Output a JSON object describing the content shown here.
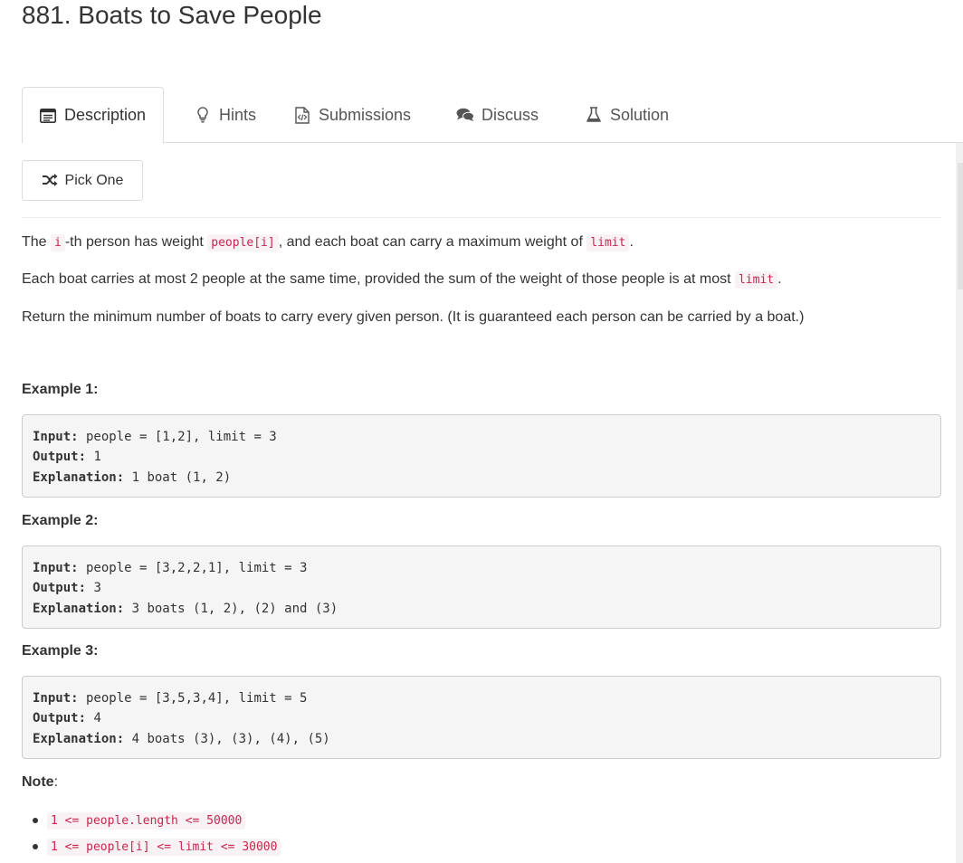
{
  "problem": {
    "title": "881. Boats to Save People"
  },
  "tabs": [
    {
      "label": "Description",
      "icon": "description-icon"
    },
    {
      "label": "Hints",
      "icon": "lightbulb-icon"
    },
    {
      "label": "Submissions",
      "icon": "file-code-icon"
    },
    {
      "label": "Discuss",
      "icon": "comments-icon"
    },
    {
      "label": "Solution",
      "icon": "flask-icon"
    }
  ],
  "pick_one": {
    "label": "Pick One",
    "icon": "shuffle-icon"
  },
  "description": {
    "p1": {
      "t1": "The ",
      "c1": "i",
      "t2": "-th person has weight ",
      "c2": "people[i]",
      "t3": ", and each boat can carry a maximum weight of ",
      "c3": "limit",
      "t4": "."
    },
    "p2": {
      "t1": "Each boat carries at most 2 people at the same time, provided the sum of the weight of those people is at most ",
      "c1": "limit",
      "t2": "."
    },
    "p3": "Return the minimum number of boats to carry every given person.  (It is guaranteed each person can be carried by a boat.)"
  },
  "examples": [
    {
      "heading": "Example 1:",
      "input_label": "Input:",
      "input": " people = [1,2], limit = 3",
      "output_label": "Output:",
      "output": " 1",
      "explanation_label": "Explanation:",
      "explanation": " 1 boat (1, 2)"
    },
    {
      "heading": "Example 2:",
      "input_label": "Input:",
      "input": " people = [3,2,2,1], limit = 3",
      "output_label": "Output:",
      "output": " 3",
      "explanation_label": "Explanation:",
      "explanation": " 3 boats (1, 2), (2) and (3)"
    },
    {
      "heading": "Example 3:",
      "input_label": "Input:",
      "input": " people = [3,5,3,4], limit = 5",
      "output_label": "Output:",
      "output": " 4",
      "explanation_label": "Explanation:",
      "explanation": " 4 boats (3), (3), (4), (5)"
    }
  ],
  "note": {
    "label": "Note",
    "colon": ":",
    "items": [
      "1 <= people.length <= 50000",
      "1 <= people[i] <= limit <= 30000"
    ]
  },
  "colors": {
    "code_text": "#c7254e",
    "code_bg": "#f9f2f4",
    "pre_bg": "#f5f5f5",
    "border": "#dddddd"
  }
}
